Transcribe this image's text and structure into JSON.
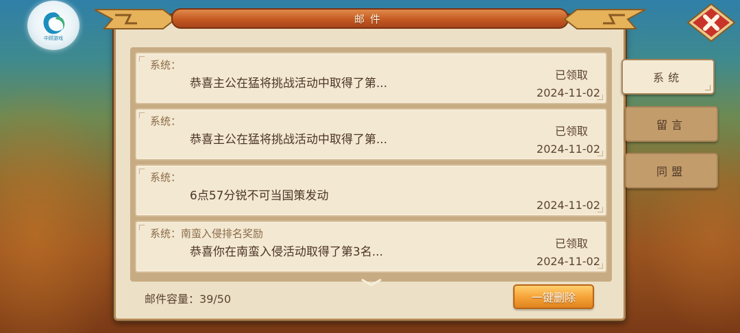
{
  "logo": {
    "text": "中顾游戏"
  },
  "dialog": {
    "title": "邮件",
    "close_icon": "close-x-icon"
  },
  "mails": [
    {
      "sender": "系统：",
      "subject": "",
      "body": "恭喜主公在猛将挑战活动中取得了第...",
      "status": "已领取",
      "date": "2024-11-02"
    },
    {
      "sender": "系统：",
      "subject": "",
      "body": "恭喜主公在猛将挑战活动中取得了第...",
      "status": "已领取",
      "date": "2024-11-02"
    },
    {
      "sender": "系统：",
      "subject": "",
      "body": "6点57分锐不可当国策发动",
      "status": "",
      "date": "2024-11-02"
    },
    {
      "sender": "系统：",
      "subject": "南蛮入侵排名奖励",
      "body": "恭喜你在南蛮入侵活动取得了第3名...",
      "status": "已领取",
      "date": "2024-11-02"
    }
  ],
  "footer": {
    "capacity_label": "邮件容量：",
    "capacity_value": "39/50",
    "delete_all_label": "一键删除"
  },
  "tabs": [
    {
      "label": "系统",
      "active": true
    },
    {
      "label": "留言",
      "active": false
    },
    {
      "label": "同盟",
      "active": false
    }
  ],
  "colors": {
    "title_bar": "#c45a22",
    "panel_bg": "#ece0c6",
    "button_orange": "#f6a43a",
    "close_red": "#c9342a"
  }
}
